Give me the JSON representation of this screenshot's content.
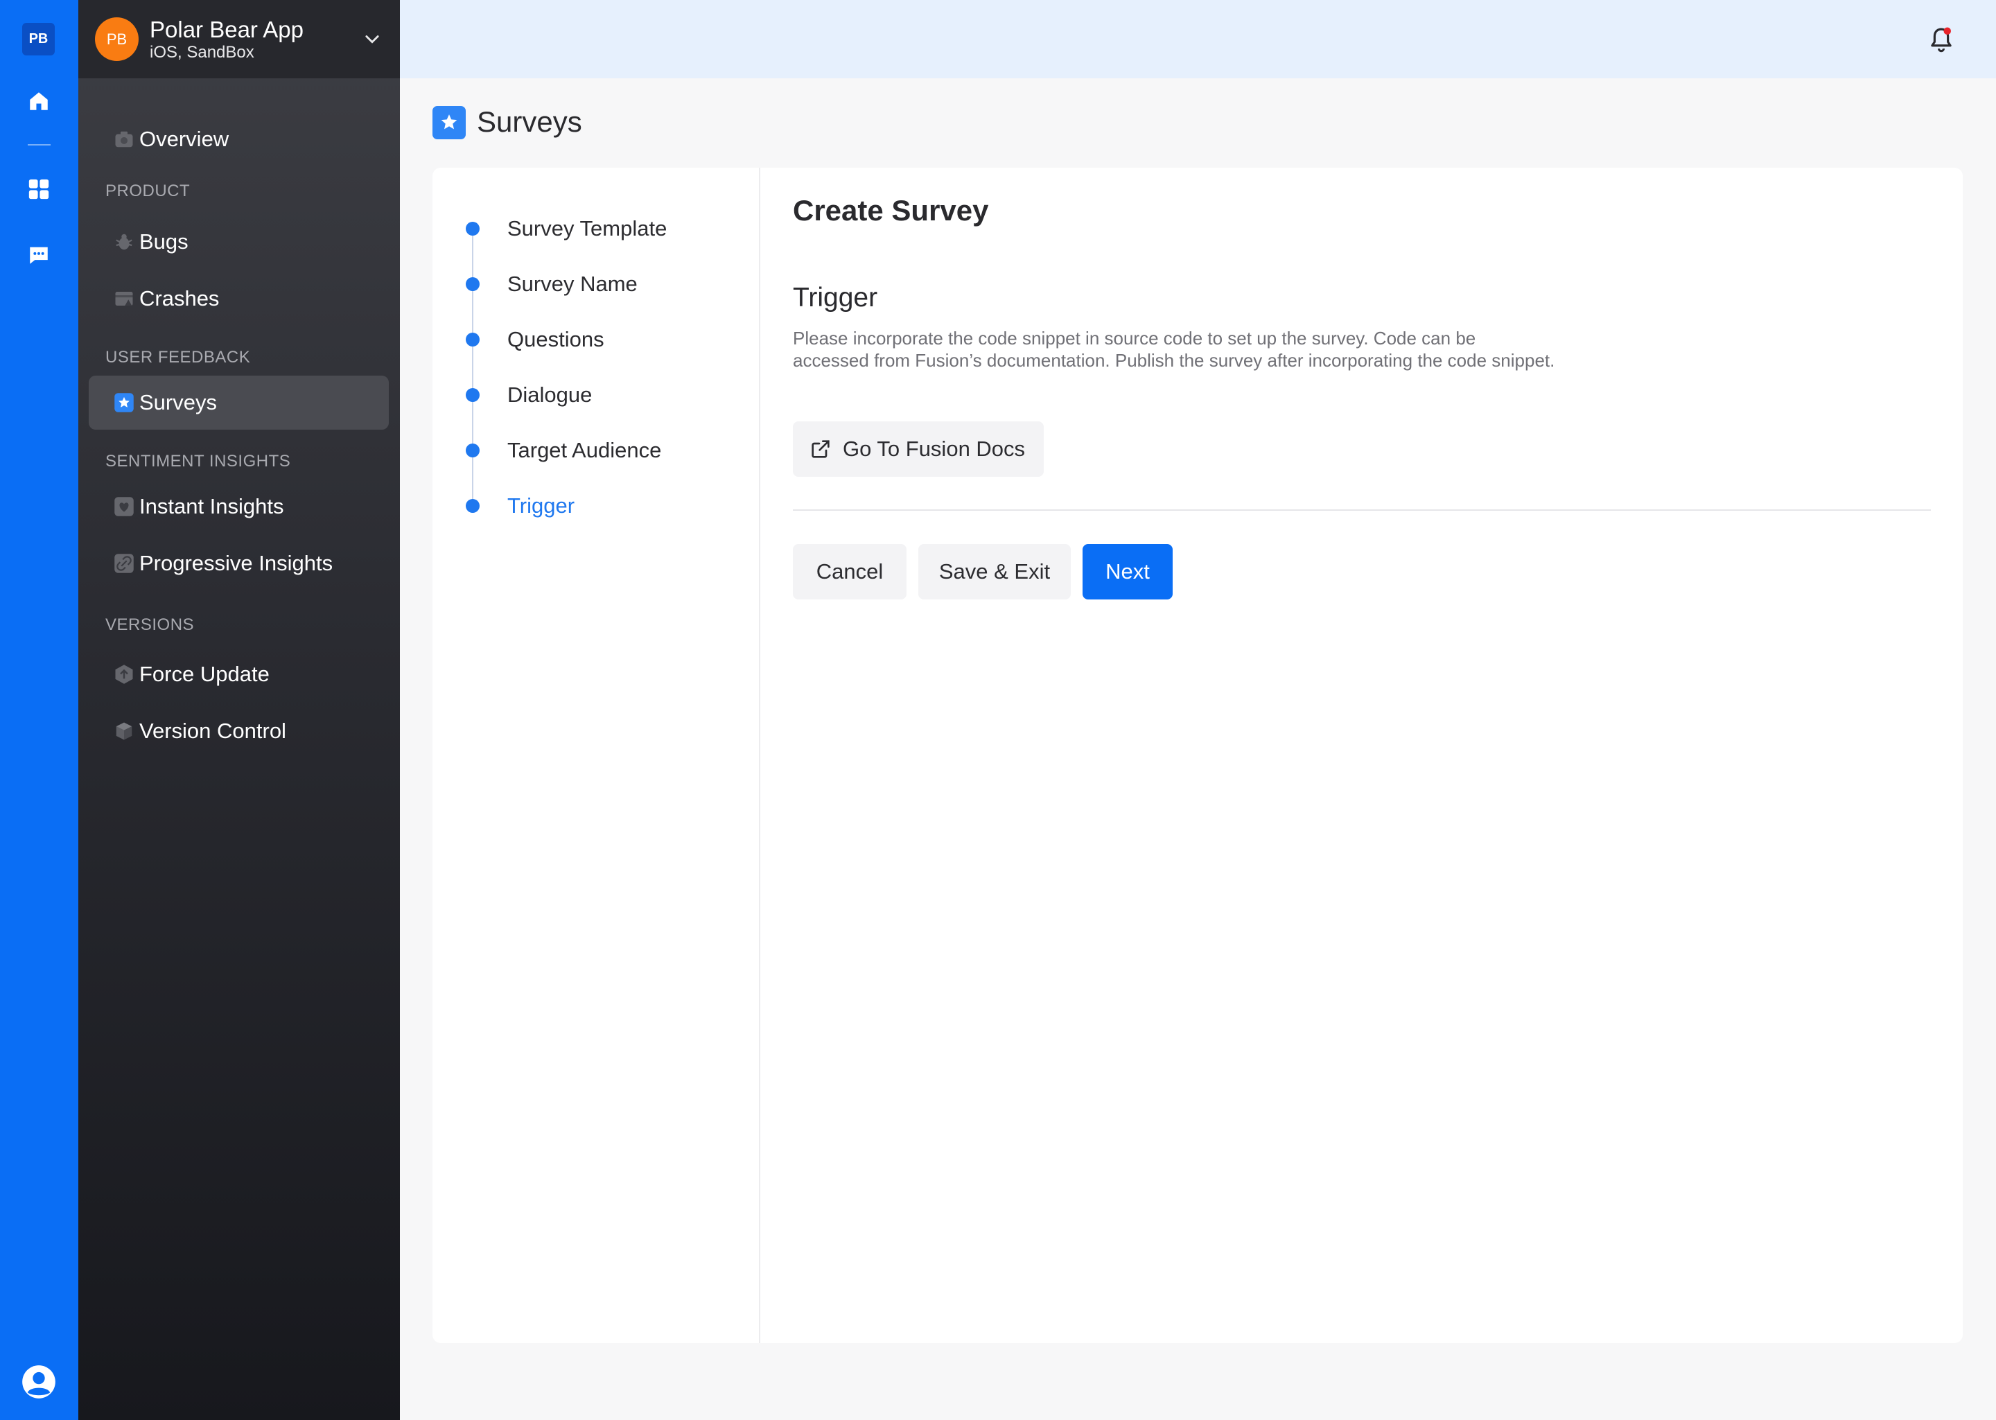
{
  "rail": {
    "logo": "PB",
    "icons": [
      "home-icon",
      "grid-icon",
      "chat-icon",
      "user-avatar-icon"
    ]
  },
  "app": {
    "avatar": "PB",
    "name": "Polar Bear App",
    "platform": "iOS, SandBox"
  },
  "sidebar": {
    "overview": "Overview",
    "sections": {
      "product": "PRODUCT",
      "user_feedback": "USER FEEDBACK",
      "sentiment": "SENTIMENT INSIGHTS",
      "versions": "VERSIONS"
    },
    "items": {
      "bugs": "Bugs",
      "crashes": "Crashes",
      "surveys": "Surveys",
      "instant": "Instant Insights",
      "progressive": "Progressive Insights",
      "force_update": "Force Update",
      "version_control": "Version Control"
    },
    "active": "Surveys"
  },
  "page": {
    "title": "Surveys"
  },
  "steps": [
    {
      "label": "Survey Template"
    },
    {
      "label": "Survey Name"
    },
    {
      "label": "Questions"
    },
    {
      "label": "Dialogue"
    },
    {
      "label": "Target Audience"
    },
    {
      "label": "Trigger",
      "current": true
    }
  ],
  "form": {
    "title": "Create Survey",
    "section_title": "Trigger",
    "description": "Please incorporate the code snippet in source code to set up the survey. Code can be accessed from Fusion’s documentation. Publish the survey after incorporating the code snippet.",
    "docs_button": "Go To Fusion Docs",
    "buttons": {
      "cancel": "Cancel",
      "save": "Save & Exit",
      "next": "Next"
    }
  },
  "colors": {
    "primary": "#0a6ef5",
    "accent_orange": "#f97c12",
    "notification_dot": "#e8232a"
  }
}
